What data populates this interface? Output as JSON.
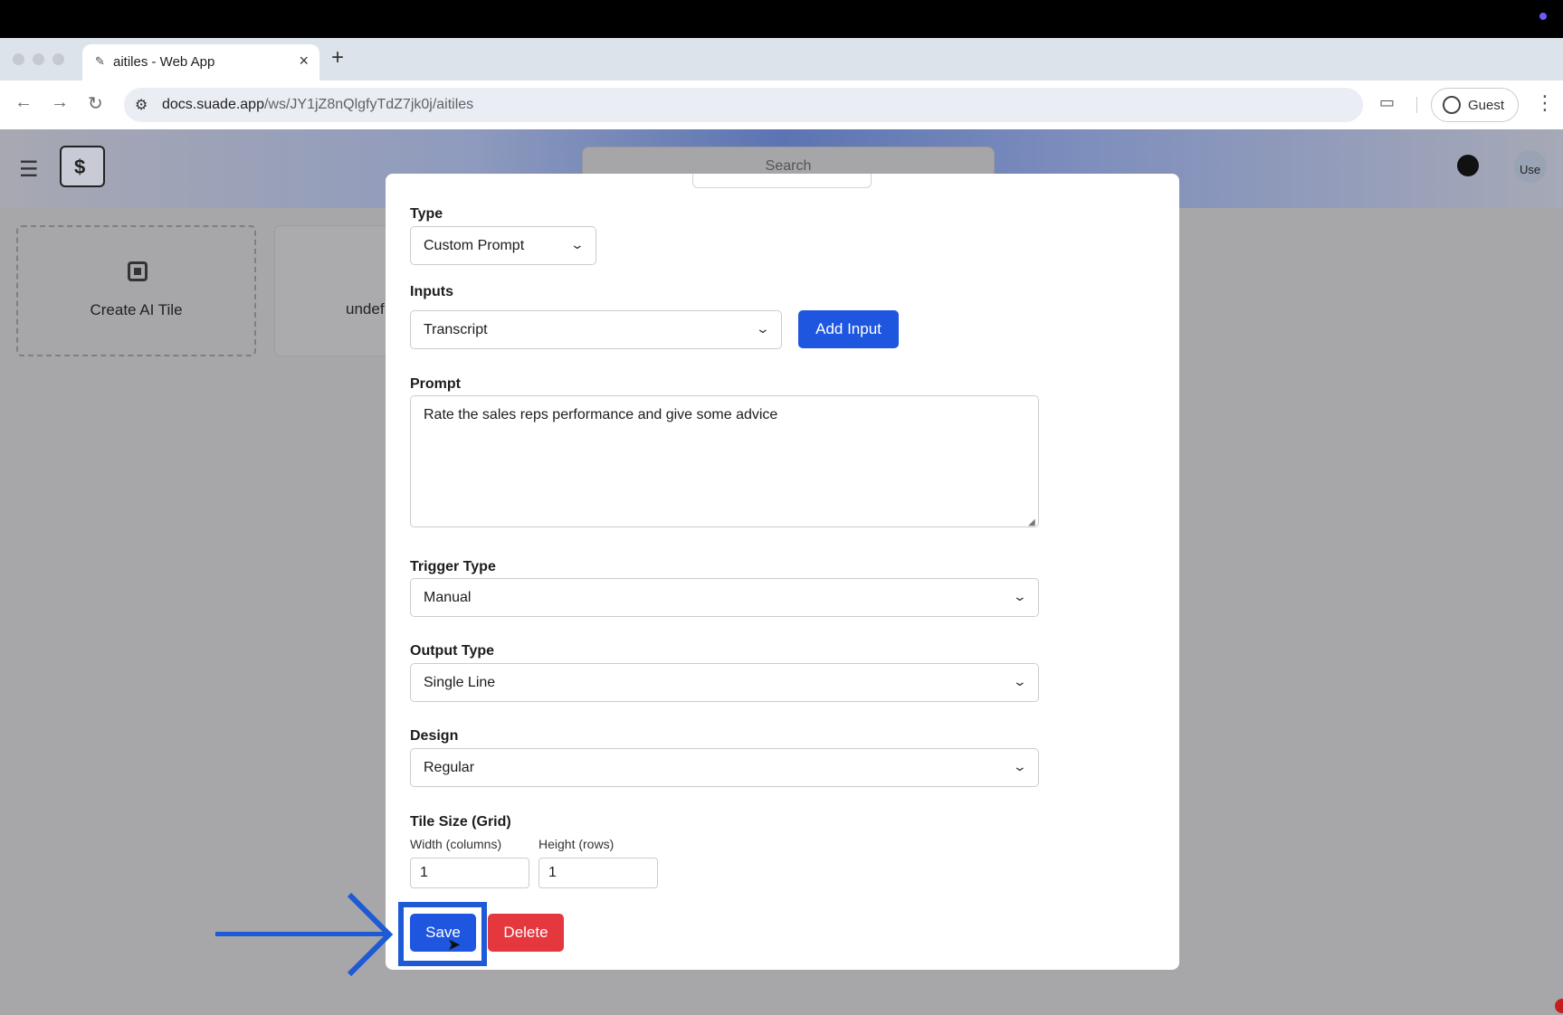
{
  "browser": {
    "tab_title": "aitiles - Web App",
    "new_tab_symbol": "+",
    "url_host": "docs.suade.app",
    "url_path": "/ws/JY1jZ8nQlgfyTdZ7jk0j/aitiles",
    "profile_label": "Guest"
  },
  "app": {
    "search_placeholder": "Search",
    "avatar_text": "Use",
    "tiles": [
      {
        "label": "Create AI Tile"
      },
      {
        "label": "undef"
      }
    ]
  },
  "modal": {
    "type": {
      "label": "Type",
      "value": "Custom Prompt"
    },
    "inputs": {
      "label": "Inputs",
      "value": "Transcript",
      "add_button": "Add Input"
    },
    "prompt": {
      "label": "Prompt",
      "value": "Rate the sales reps performance and give some advice"
    },
    "trigger_type": {
      "label": "Trigger Type",
      "value": "Manual"
    },
    "output_type": {
      "label": "Output Type",
      "value": "Single Line"
    },
    "design": {
      "label": "Design",
      "value": "Regular"
    },
    "tile_size": {
      "label": "Tile Size (Grid)",
      "width_label": "Width (columns)",
      "width_value": "1",
      "height_label": "Height (rows)",
      "height_value": "1"
    },
    "save_label": "Save",
    "delete_label": "Delete"
  },
  "colors": {
    "primary": "#1f56e0",
    "danger": "#e5373e",
    "annotation": "#1f5ad6"
  }
}
